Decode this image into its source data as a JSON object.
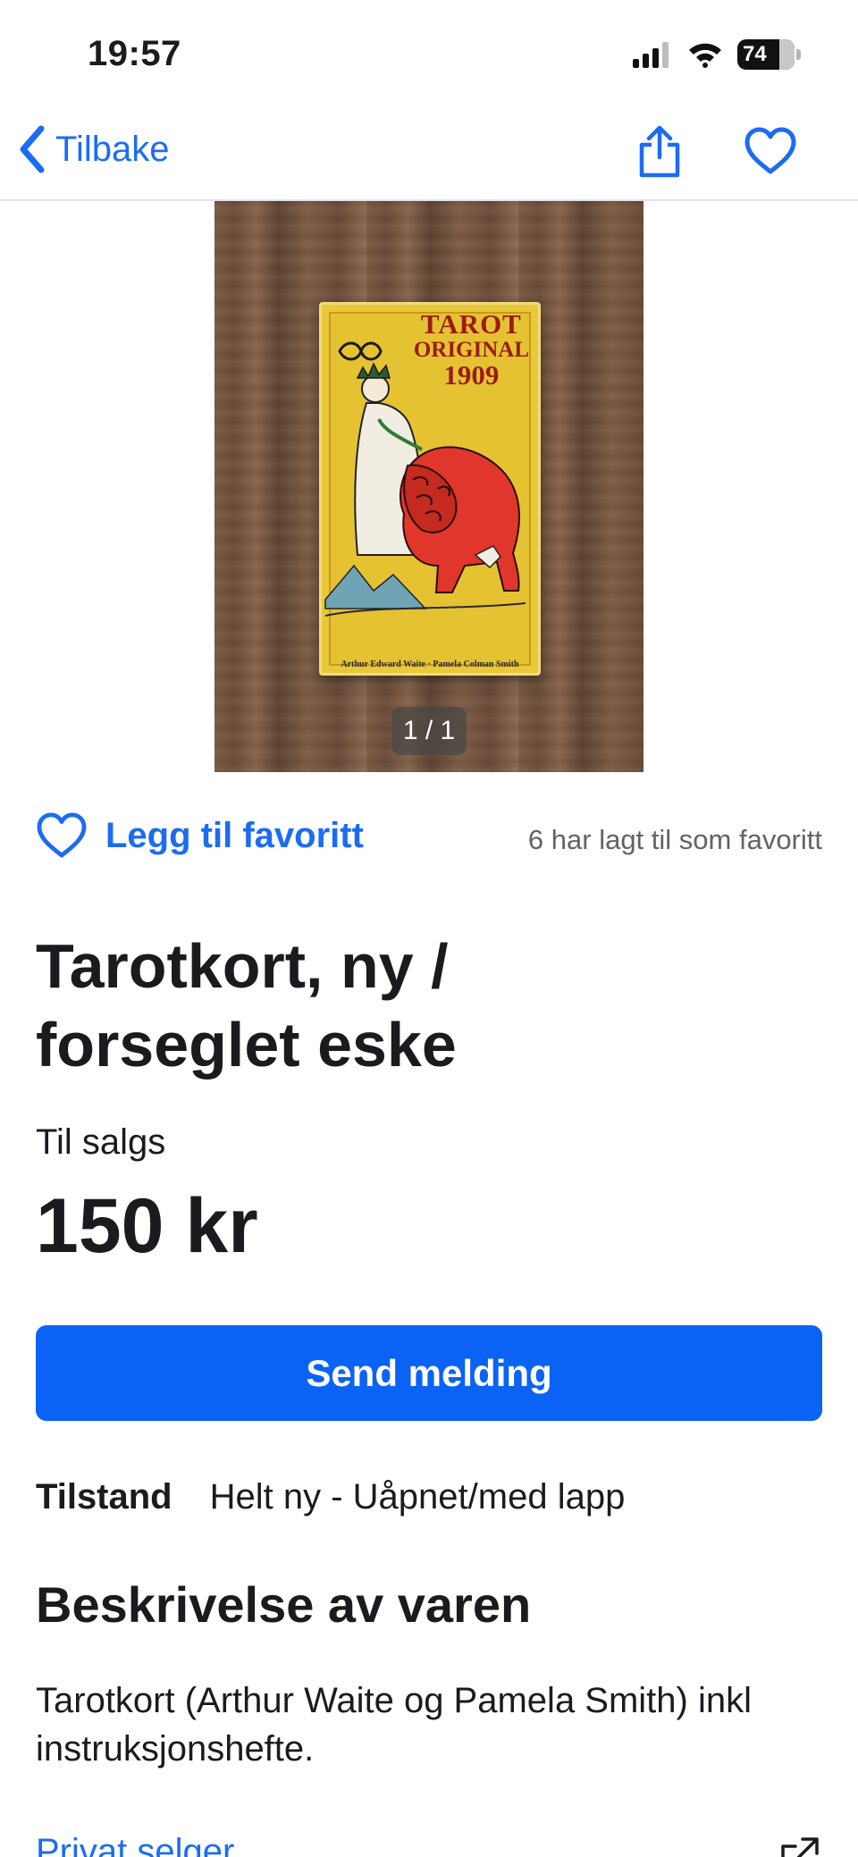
{
  "status_bar": {
    "time": "19:57",
    "battery_level": "74",
    "battery_fraction": 0.74,
    "icons": [
      "cellular-signal-icon",
      "wifi-icon",
      "battery-icon"
    ]
  },
  "nav": {
    "back_label": "Tilbake",
    "icons": [
      "chevron-left-icon",
      "share-icon",
      "heart-outline-icon"
    ]
  },
  "gallery": {
    "page_indicator": "1 / 1",
    "product_image": {
      "title_line1": "TAROT",
      "title_line2": "ORIGINAL",
      "title_line3": "1909",
      "authors": "Arthur Edward Waite · Pamela Colman Smith"
    }
  },
  "favorite": {
    "add_label": "Legg til favoritt",
    "count_text": "6 har lagt til som favoritt"
  },
  "listing": {
    "title": "Tarotkort, ny / forseglet eske",
    "sale_type": "Til salgs",
    "price": "150 kr"
  },
  "actions": {
    "send_message_label": "Send melding"
  },
  "details": {
    "condition_label": "Tilstand",
    "condition_value": "Helt ny - Uåpnet/med lapp"
  },
  "description": {
    "heading": "Beskrivelse av varen",
    "text": "Tarotkort (Arthur Waite og Pamela Smith) inkl instruksjonshefte."
  },
  "seller": {
    "link_label": "Privat selger"
  },
  "colors": {
    "accent": "#0a63f5",
    "link": "#1c6cf2",
    "text": "#1b1b1f",
    "muted": "#62626b"
  }
}
